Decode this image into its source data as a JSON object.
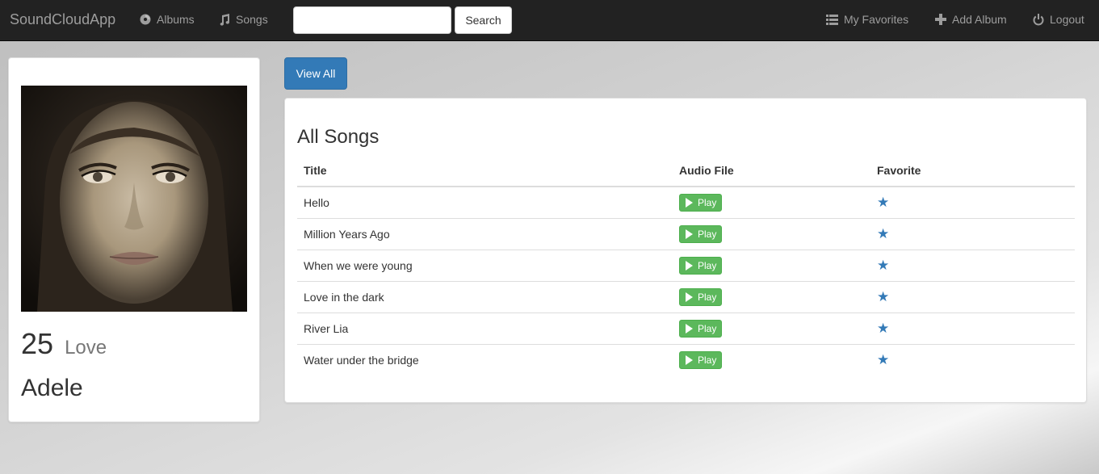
{
  "navbar": {
    "brand": "SoundCloudApp",
    "links": {
      "albums": "Albums",
      "songs": "Songs",
      "favorites": "My Favorites",
      "add_album": "Add Album",
      "logout": "Logout"
    },
    "search": {
      "value": "",
      "placeholder": "",
      "button_label": "Search"
    }
  },
  "album": {
    "title": "25",
    "subtitle": "Love",
    "artist": "Adele"
  },
  "view_all_label": "View All",
  "songs_panel": {
    "heading": "All Songs",
    "columns": {
      "title": "Title",
      "audio": "Audio File",
      "favorite": "Favorite"
    },
    "play_label": "Play",
    "rows": [
      {
        "title": "Hello",
        "favorite": true
      },
      {
        "title": "Million Years Ago",
        "favorite": true
      },
      {
        "title": "When we were young",
        "favorite": true
      },
      {
        "title": "Love in the dark",
        "favorite": true
      },
      {
        "title": "River Lia",
        "favorite": true
      },
      {
        "title": "Water under the bridge",
        "favorite": true
      }
    ]
  },
  "colors": {
    "navbar_bg": "#222222",
    "nav_text": "#9d9d9d",
    "primary": "#337ab7",
    "success": "#5cb85c",
    "star": "#337ab7"
  }
}
